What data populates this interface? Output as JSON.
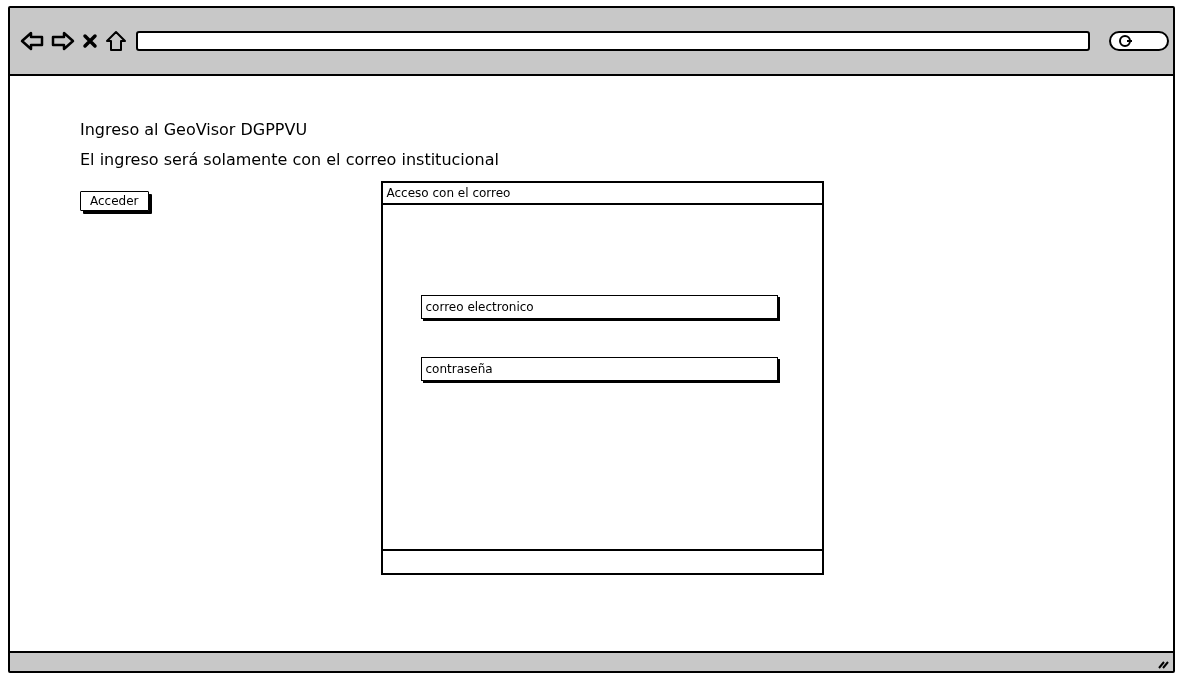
{
  "page": {
    "title": "Ingreso al GeoVisor DGPPVU",
    "subtitle": "El ingreso será solamente con el correo institucional",
    "button": "Acceder"
  },
  "dialog": {
    "title": "Acceso con el correo",
    "fields": [
      {
        "placeholder": "correo electronico"
      },
      {
        "placeholder": "contraseña"
      }
    ]
  }
}
